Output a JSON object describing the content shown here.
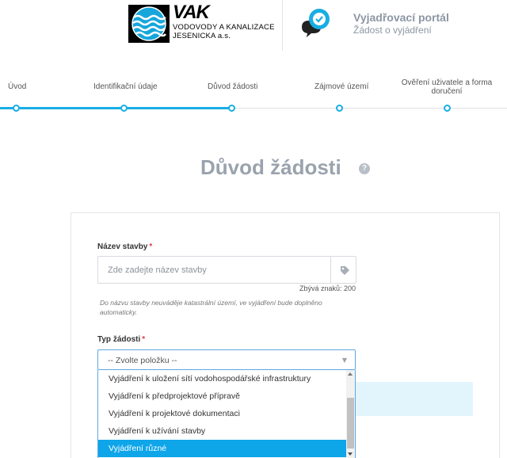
{
  "header": {
    "logo": {
      "brand": "VAK",
      "line1": "VODOVODY A KANALIZACE",
      "line2": "JESENICKA a.s."
    },
    "portal": {
      "title": "Vyjadřovací portál",
      "subtitle": "Žádost o vyjádření",
      "icon": "chat-check-icon"
    }
  },
  "stepper": {
    "steps": [
      {
        "label": "Úvod",
        "state": "done"
      },
      {
        "label": "Identifikační údaje",
        "state": "done"
      },
      {
        "label": "Důvod žádosti",
        "state": "current"
      },
      {
        "label": "Zájmové území",
        "state": "upcoming"
      },
      {
        "label": "Ověření uživatele a forma doručení",
        "state": "upcoming"
      }
    ]
  },
  "main": {
    "title": "Důvod žádosti",
    "help_icon": "?",
    "form": {
      "stavba": {
        "label": "Název stavby",
        "required_mark": "*",
        "placeholder": "Zde zadejte název stavby",
        "value": "",
        "addon_icon": "tag-icon",
        "counter": "Zbývá znaků: 200",
        "hint": "Do názvu stavby neuváděje katastrální území, ve vyjádření bude doplněno automaticky."
      },
      "typ": {
        "label": "Typ žádosti",
        "required_mark": "*",
        "selected": "-- Zvolte položku --",
        "options": [
          "Vyjádření k uložení sítí vodohospodářské infrastruktury",
          "Vyjádření k předprojektové přípravě",
          "Vyjádření k projektové dokumentaci",
          "Vyjádření k užívání stavby",
          "Vyjádření různé"
        ],
        "highlighted_option": "Vyjádření různé"
      }
    }
  },
  "colors": {
    "accent": "#18aee3",
    "highlight": "#0ea5e9",
    "title_gray": "#9aa3ad",
    "required": "#e03c3c",
    "info_bg": "#e3f5fc"
  }
}
